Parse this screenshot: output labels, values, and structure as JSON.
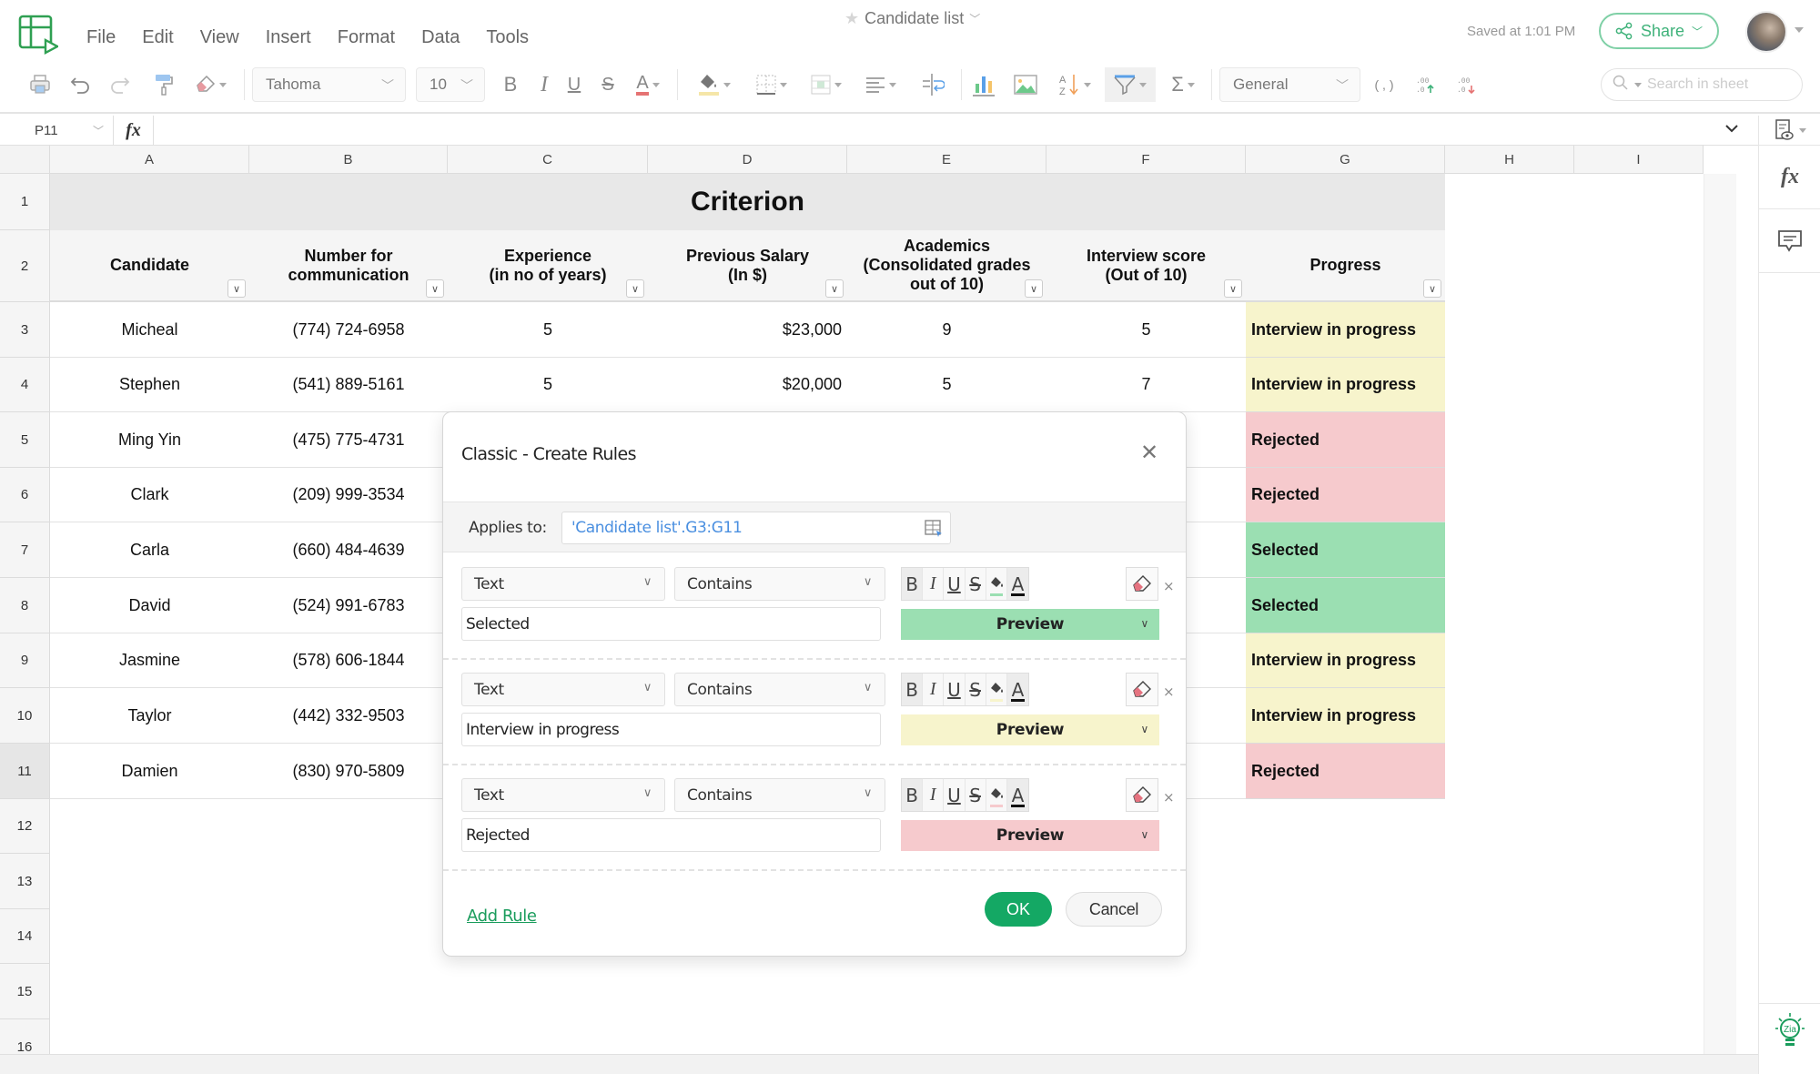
{
  "app": {
    "doc_title": "Candidate list",
    "saved_status": "Saved at 1:01 PM",
    "share_label": "Share",
    "menu": [
      "File",
      "Edit",
      "View",
      "Insert",
      "Format",
      "Data",
      "Tools"
    ]
  },
  "toolbar": {
    "font_family": "Tahoma",
    "font_size": "10",
    "number_format": "General",
    "bold": "B",
    "italic": "I",
    "underline": "U",
    "strike": "S",
    "font_color_glyph": "A",
    "font_color": "#e57373",
    "fill_color": "#f5e6a8",
    "comma_glyph": "( , )",
    "search_placeholder": "Search in sheet"
  },
  "formula_bar": {
    "cell_ref": "P11",
    "fx_label": "fx",
    "formula": ""
  },
  "right_rail": {
    "fx_label": "fx"
  },
  "sheet": {
    "columns": [
      "A",
      "B",
      "C",
      "D",
      "E",
      "F",
      "G",
      "H",
      "I"
    ],
    "rows": [
      "1",
      "2",
      "3",
      "4",
      "5",
      "6",
      "7",
      "8",
      "9",
      "10",
      "11",
      "12",
      "13",
      "14",
      "15",
      "16"
    ],
    "title": "Criterion",
    "headers": [
      "Candidate",
      "Number for\ncommunication",
      "Experience\n(in no of years)",
      "Previous Salary\n(In $)",
      "Academics\n(Consolidated grades\nout of 10)",
      "Interview score\n(Out of 10)",
      "Progress"
    ],
    "data": [
      {
        "candidate": "Micheal",
        "phone": "(774) 724-6958",
        "experience": "5",
        "salary": "$23,000",
        "academics": "9",
        "interview": "5",
        "progress": "Interview in progress",
        "status": "progress"
      },
      {
        "candidate": "Stephen",
        "phone": "(541) 889-5161",
        "experience": "5",
        "salary": "$20,000",
        "academics": "5",
        "interview": "7",
        "progress": "Interview in progress",
        "status": "progress"
      },
      {
        "candidate": "Ming Yin",
        "phone": "(475) 775-4731",
        "progress": "Rejected",
        "status": "rejected"
      },
      {
        "candidate": "Clark",
        "phone": "(209) 999-3534",
        "progress": "Rejected",
        "status": "rejected"
      },
      {
        "candidate": "Carla",
        "phone": "(660) 484-4639",
        "progress": "Selected",
        "status": "selected"
      },
      {
        "candidate": "David",
        "phone": "(524) 991-6783",
        "progress": "Selected",
        "status": "selected"
      },
      {
        "candidate": "Jasmine",
        "phone": "(578) 606-1844",
        "progress": "Interview in progress",
        "status": "progress"
      },
      {
        "candidate": "Taylor",
        "phone": "(442) 332-9503",
        "progress": "Interview in progress",
        "status": "progress"
      },
      {
        "candidate": "Damien",
        "phone": "(830) 970-5809",
        "progress": "Rejected",
        "status": "rejected"
      }
    ],
    "status_colors": {
      "progress": "#f7f4cc",
      "rejected": "#f6cacd",
      "selected": "#9bdfb2"
    }
  },
  "dialog": {
    "title": "Classic - Create Rules",
    "applies_label": "Applies to:",
    "applies_value": "'Candidate list'.G3:G11",
    "rules": [
      {
        "type": "Text",
        "condition": "Contains",
        "value": "Selected",
        "preview": "Preview",
        "fill": "#9bdfb2"
      },
      {
        "type": "Text",
        "condition": "Contains",
        "value": "Interview in progress",
        "preview": "Preview",
        "fill": "#f7f4cc"
      },
      {
        "type": "Text",
        "condition": "Contains",
        "value": "Rejected",
        "preview": "Preview",
        "fill": "#f6cacd"
      }
    ],
    "format_buttons": [
      "B",
      "I",
      "U",
      "S",
      "",
      "A"
    ],
    "remove_glyph": "×",
    "add_rule_label": "Add Rule",
    "ok_label": "OK",
    "cancel_label": "Cancel"
  }
}
